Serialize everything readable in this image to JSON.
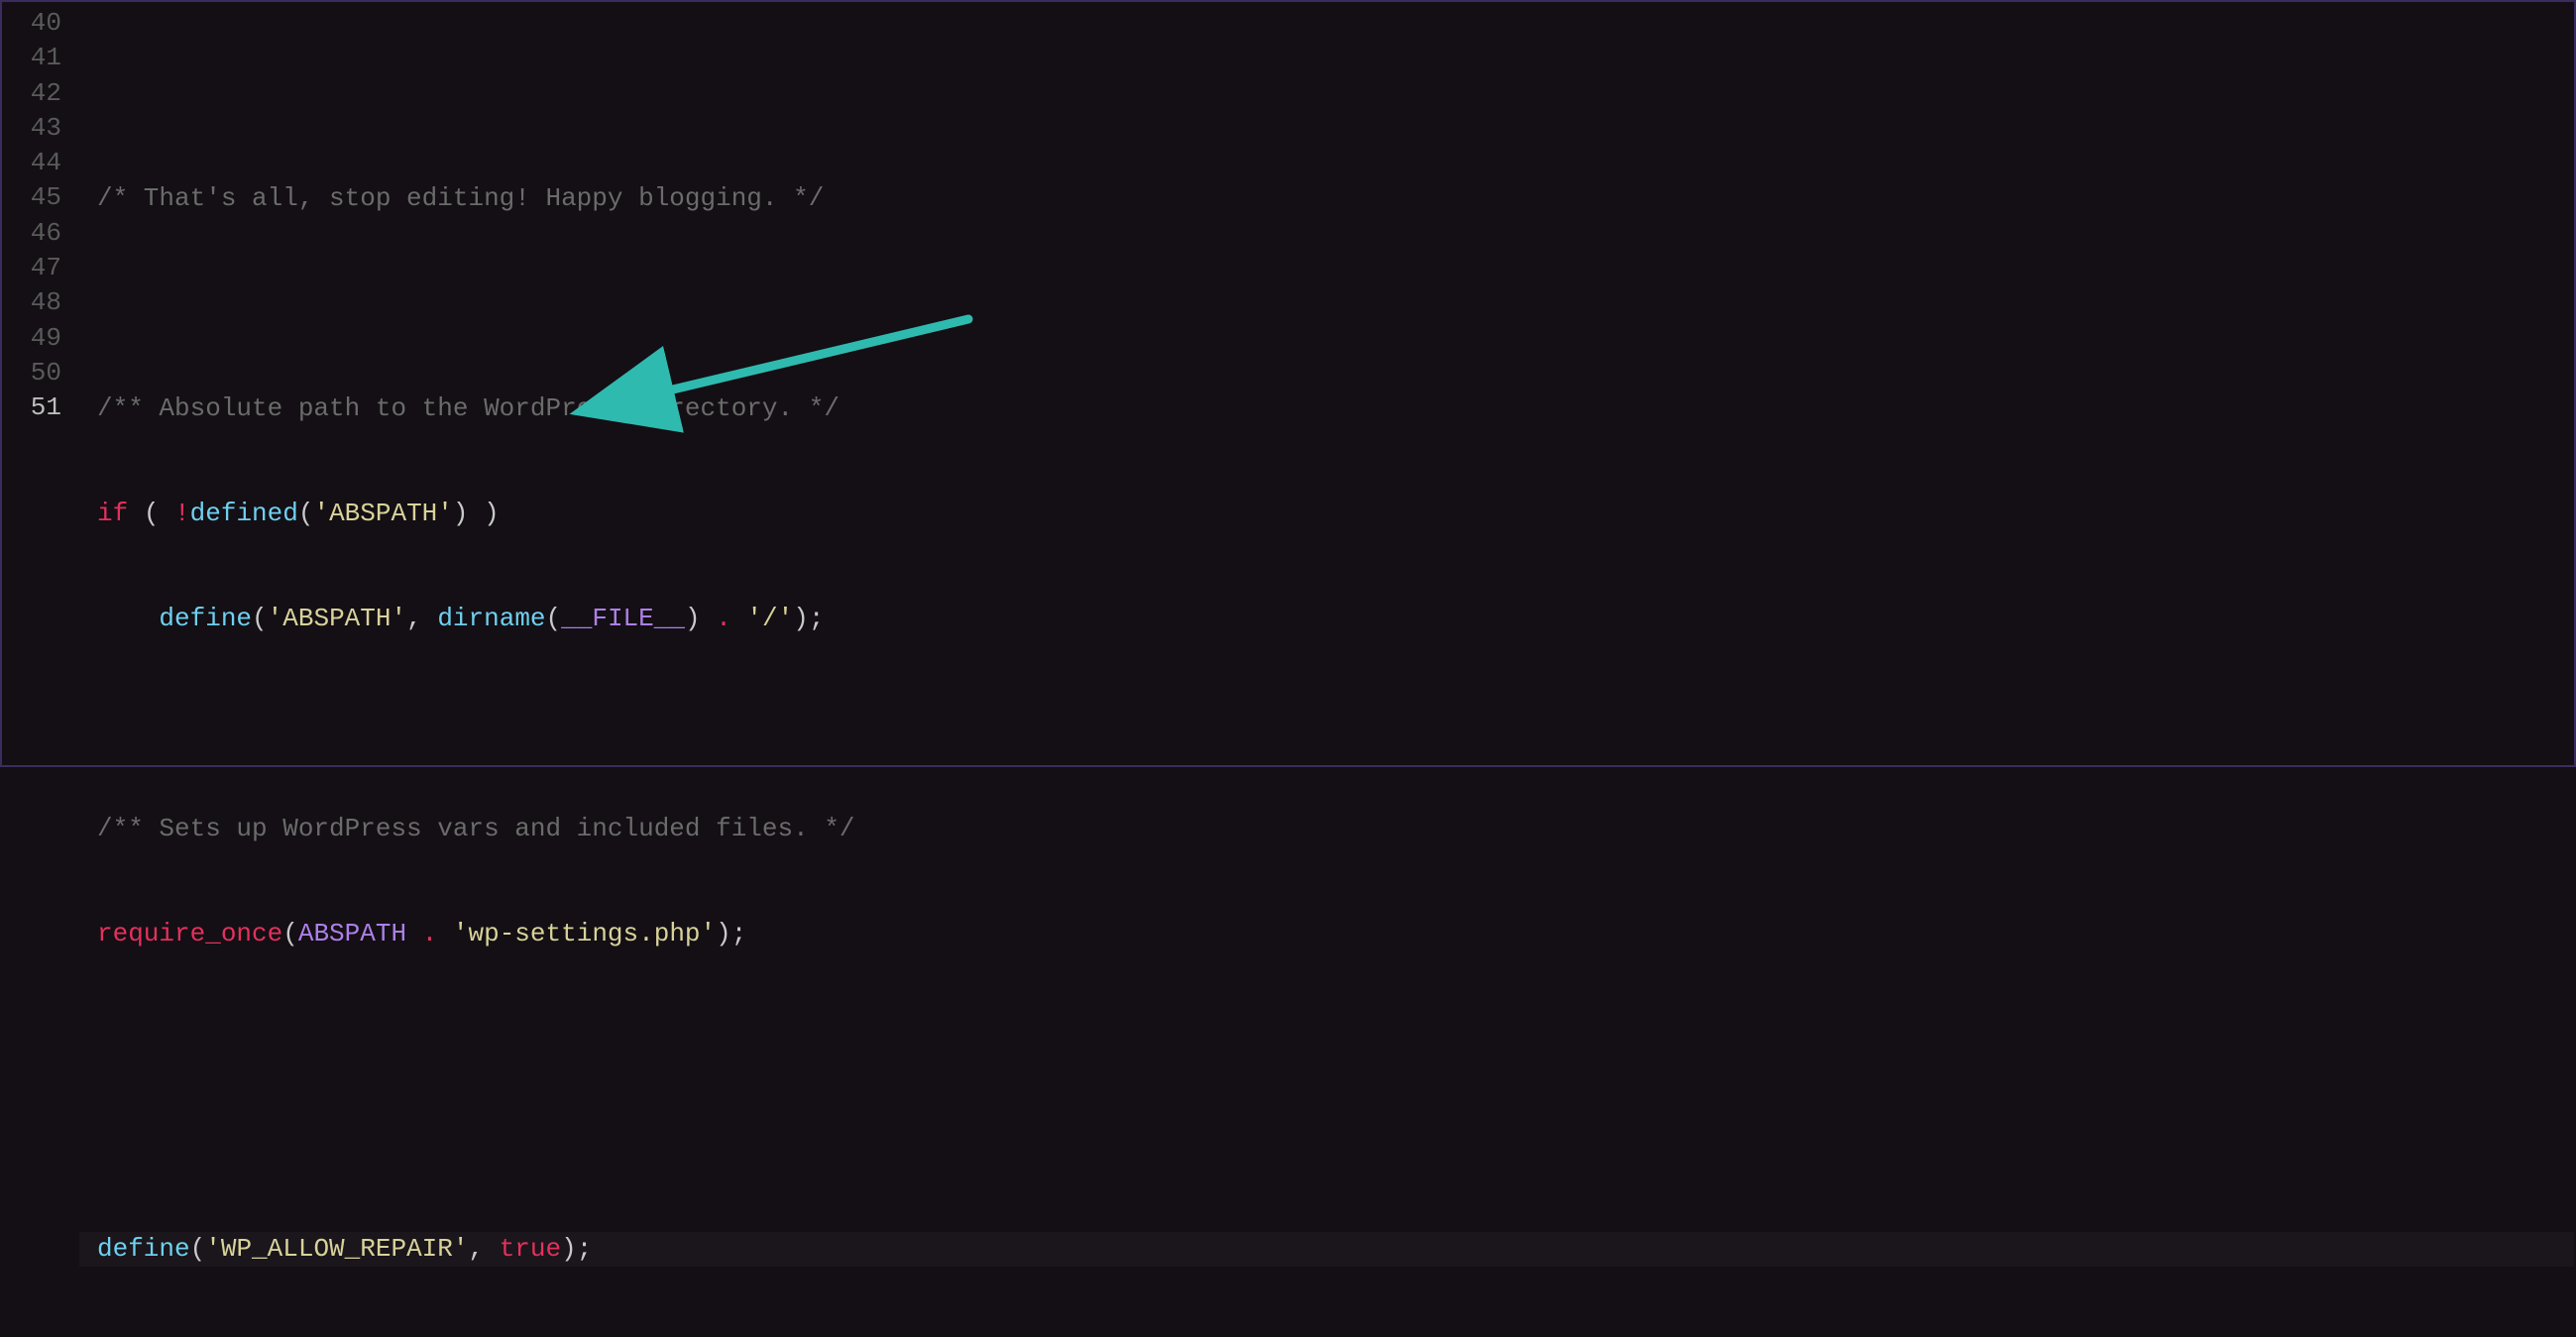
{
  "lines": {
    "start": 40,
    "end": 51,
    "current": 51
  },
  "code": {
    "l40": "",
    "l41_comment": "/* That's all, stop editing! Happy blogging. */",
    "l42": "",
    "l43_comment": "/** Absolute path to the WordPress directory. */",
    "l44_if": "if",
    "l44_paren1": " ( ",
    "l44_bang": "!",
    "l44_defined": "defined",
    "l44_p_open": "(",
    "l44_str": "'ABSPATH'",
    "l44_p_close": ")",
    "l44_paren2": " )",
    "l45_indent": "    ",
    "l45_define": "define",
    "l45_p_open": "(",
    "l45_str1": "'ABSPATH'",
    "l45_comma": ", ",
    "l45_dirname": "dirname",
    "l45_p2_open": "(",
    "l45_file": "__FILE__",
    "l45_p2_close": ")",
    "l45_sp1": " ",
    "l45_dot": ".",
    "l45_sp2": " ",
    "l45_str2": "'/'",
    "l45_end": ");",
    "l46": "",
    "l47_comment": "/** Sets up WordPress vars and included files. */",
    "l48_require": "require_once",
    "l48_p_open": "(",
    "l48_const": "ABSPATH",
    "l48_sp1": " ",
    "l48_dot": ".",
    "l48_sp2": " ",
    "l48_str": "'wp-settings.php'",
    "l48_end": ");",
    "l49": "",
    "l50": "",
    "l51_define": "define",
    "l51_p_open": "(",
    "l51_str": "'WP_ALLOW_REPAIR'",
    "l51_comma": ", ",
    "l51_true": "true",
    "l51_end": ");"
  },
  "gutter": {
    "n40": "40",
    "n41": "41",
    "n42": "42",
    "n43": "43",
    "n44": "44",
    "n45": "45",
    "n46": "46",
    "n47": "47",
    "n48": "48",
    "n49": "49",
    "n50": "50",
    "n51": "51"
  },
  "annotation": {
    "arrow_color": "#2fbab0"
  }
}
